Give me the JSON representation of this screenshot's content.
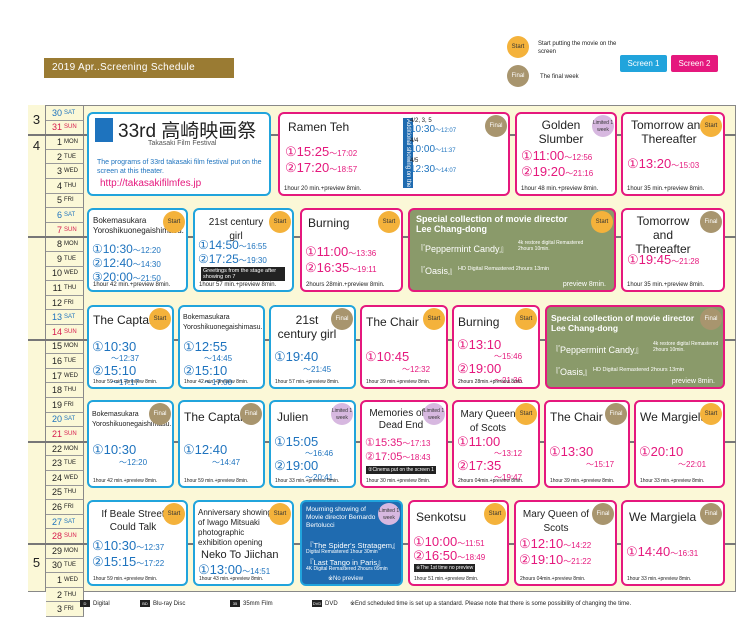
{
  "header": {
    "band": "2019 Apr..Screening Schedule"
  },
  "legend": {
    "start_badge": "Start",
    "start_text": "Start putting the movie on the screen",
    "final_badge": "Final",
    "final_text": "The final week",
    "screen1": "Screen 1",
    "screen2": "Screen 2"
  },
  "festival": {
    "logo": "33rd 高崎映画祭",
    "sub": "Takasaki Film Festival",
    "desc": "The programs of 33rd takasaki film festival put on the screen at this theater.",
    "url": "http://takasakifilmfes.jp"
  },
  "months": [
    "3",
    "4",
    "5"
  ],
  "days": [
    {
      "n": "30",
      "w": "SAT"
    },
    {
      "n": "31",
      "w": "SUN"
    },
    {
      "n": "1",
      "w": "MON"
    },
    {
      "n": "2",
      "w": "TUE"
    },
    {
      "n": "3",
      "w": "WED"
    },
    {
      "n": "4",
      "w": "THU"
    },
    {
      "n": "5",
      "w": "FRI"
    },
    {
      "n": "6",
      "w": "SAT"
    },
    {
      "n": "7",
      "w": "SUN"
    },
    {
      "n": "8",
      "w": "MON"
    },
    {
      "n": "9",
      "w": "TUE"
    },
    {
      "n": "10",
      "w": "WED"
    },
    {
      "n": "11",
      "w": "THU"
    },
    {
      "n": "12",
      "w": "FRI"
    },
    {
      "n": "13",
      "w": "SAT"
    },
    {
      "n": "14",
      "w": "SUN"
    },
    {
      "n": "15",
      "w": "MON"
    },
    {
      "n": "16",
      "w": "TUE"
    },
    {
      "n": "17",
      "w": "WED"
    },
    {
      "n": "18",
      "w": "THU"
    },
    {
      "n": "19",
      "w": "FRI"
    },
    {
      "n": "20",
      "w": "SAT"
    },
    {
      "n": "21",
      "w": "SUN"
    },
    {
      "n": "22",
      "w": "MON"
    },
    {
      "n": "23",
      "w": "TUE"
    },
    {
      "n": "24",
      "w": "WED"
    },
    {
      "n": "25",
      "w": "THU"
    },
    {
      "n": "26",
      "w": "FRI"
    },
    {
      "n": "27",
      "w": "SAT"
    },
    {
      "n": "28",
      "w": "SUN"
    },
    {
      "n": "29",
      "w": "MON"
    },
    {
      "n": "30",
      "w": "TUE"
    },
    {
      "n": "1",
      "w": "WED"
    },
    {
      "n": "2",
      "w": "THU"
    },
    {
      "n": "3",
      "w": "FRI"
    }
  ],
  "films": {
    "ramen": {
      "title": "Ramen Teh",
      "t1": "①15:25",
      "e1": "～17:02",
      "t2": "②17:20",
      "e2": "～18:57",
      "foot": "1hour 20 min.+preview 8min.",
      "badge": "Final"
    },
    "addl": {
      "text": "Additional showing on the 1st floor",
      "d1": "4/2, 3, 5",
      "t1": "10:30",
      "e1": "～12:07",
      "d2": "4/4",
      "t2": "10:00",
      "e2": "～11:37",
      "d3": "4/5",
      "t3": "12:30",
      "e3": "～14:07"
    },
    "golden": {
      "title": "Golden Slumber",
      "t1": "①11:00",
      "e1": "～12:56",
      "t2": "②19:20",
      "e2": "～21:16",
      "foot": "1hour 48 min.+preview 8min.",
      "badge": "Limited 1 week"
    },
    "tomorrow1": {
      "title": "Tomorrow and Thereafter",
      "t1": "①13:20",
      "e1": "～15:03",
      "foot": "1hour 35 min.+preview 8min.",
      "badge": "Start"
    },
    "boke1": {
      "title": "Bokemasukara Yoroshikuonegaishimasu.",
      "t1": "①10:30",
      "e1": "～12:20",
      "t2": "②12:40",
      "e2": "～14:30",
      "t3": "③20:00",
      "e3": "～21:50",
      "foot": "1hour 42 min.+preview 8min.",
      "badge": "Start"
    },
    "century1": {
      "title": "21st century girl",
      "t1": "①14:50",
      "e1": "～16:55",
      "t2": "②17:25",
      "e2": "～19:30",
      "note": "Greetings from the stage after showing on 7",
      "foot": "1hour 57 min.+preview 8min.",
      "badge": "Start"
    },
    "burning1": {
      "title": "Burning",
      "t1": "①11:00",
      "e1": "～13:36",
      "t2": "②16:35",
      "e2": "～19:11",
      "foot": "2hours 28min.+preview 8min.",
      "badge": "Start"
    },
    "special1": {
      "title": "Special collection of movie director Lee Chang-dong",
      "l1": "『Peppermint Candy』",
      "l1b": "4k restore digital Remastered 2hours 10min.",
      "l2": "『Oasis』",
      "l2b": "HD Digital Remastered 2hours 13min",
      "foot": "preview 8min.",
      "badge": "Start"
    },
    "tomorrow2": {
      "title": "Tomorrow and Thereafter",
      "t1": "①19:45",
      "e1": "～21:28",
      "foot": "1hour 35 min.+preview 8min.",
      "badge": "Final"
    },
    "captain1": {
      "title": "The Captain",
      "t1": "①10:30",
      "e1": "～12:37",
      "t2": "②15:10",
      "e2": "～17:17",
      "foot": "1hour 59 min.+preview 8min.",
      "badge": "Start"
    },
    "boke2": {
      "title": "Bokemasukara Yoroshikuonegaishimasu.",
      "t1": "①12:55",
      "e1": "～14:45",
      "t2": "②15:10",
      "e2": "～17:00",
      "foot": "1hour 42 min.+preview 8min.",
      "badge": ""
    },
    "century2": {
      "title": "21st century girl",
      "t1": "①19:40",
      "e1": "～21:45",
      "foot": "1hour 57 min.+preview 8min.",
      "badge": "Final"
    },
    "chair1": {
      "title": "The Chair",
      "t1": "①10:45",
      "e1": "～12:32",
      "foot": "1hour 39 min.+preview 8min.",
      "badge": "Start"
    },
    "burning2": {
      "title": "Burning",
      "t1": "①13:10",
      "e1": "～15:46",
      "t2": "②19:00",
      "e2": "～21:36",
      "foot": "2hours 28min.+preview 8min.",
      "badge": "Start"
    },
    "special2": {
      "title": "Special collection of movie director Lee Chang-dong",
      "l1": "『Peppermint Candy』",
      "l1b": "4k restore digital Remastered 2hours 10min.",
      "l2": "『Oasis』",
      "l2b": "HD Digital Remastered 2hours 13min",
      "foot": "preview 8min.",
      "badge": "Final"
    },
    "boke3": {
      "title": "Bokemasukara Yoroshikuonegaishimasu.",
      "t1": "①10:30",
      "e1": "～12:20",
      "foot": "1hour 42 min.+preview 8min.",
      "badge": "Final"
    },
    "captain2": {
      "title": "The Captain",
      "t1": "①12:40",
      "e1": "～14:47",
      "foot": "1hour 59 min.+preview 8min.",
      "badge": "Final"
    },
    "julien": {
      "title": "Julien",
      "t1": "①15:05",
      "e1": "～16:46",
      "t2": "②19:00",
      "e2": "～20:41",
      "foot": "1hour 33 min.+preview 8min.",
      "badge": "Limited 1 week"
    },
    "memories": {
      "title": "Memories of a Dead End",
      "t1": "①15:35",
      "e1": "～17:13",
      "t2": "②17:05",
      "e2": "～18:43",
      "note": "②Cinema put on the screen 1",
      "foot": "1hour 30 min.+preview 8min.",
      "badge": "Limited 1 week"
    },
    "mary1": {
      "title": "Mary Queen of Scots",
      "t1": "①11:00",
      "e1": "～13:12",
      "t2": "②17:35",
      "e2": "～19:47",
      "foot": "2hours 04min.+preview 8min.",
      "badge": "Start"
    },
    "chair2": {
      "title": "The Chair",
      "t1": "①13:30",
      "e1": "～15:17",
      "foot": "1hour 39 min.+preview 8min.",
      "badge": "Final"
    },
    "margiela1": {
      "title": "We Margiela",
      "t1": "①20:10",
      "e1": "～22:01",
      "foot": "1hour 33 min.+preview 8min.",
      "badge": "Start"
    },
    "beale": {
      "title": "If Beale Street Could Talk",
      "t1": "①10:30",
      "e1": "～12:37",
      "t2": "②15:15",
      "e2": "～17:22",
      "foot": "1hour 59 min.+preview 8min.",
      "badge": "Start"
    },
    "neko": {
      "title": "Anniversary showing of Iwago Mitsuaki photographic exhibition opening",
      "title2": "Neko To Jiichan",
      "t1": "①13:00",
      "e1": "～14:51",
      "foot": "1hour 43 min.+preview 8min.",
      "badge": "Start"
    },
    "mourning": {
      "title": "Mourning showing of Movie director Bernardo Bertolucci",
      "l1": "『The Spider's Stratagem』",
      "l1b": "Digital Remastered 1hour 30min",
      "l2": "『Last Tango in Paris』",
      "l2b": "4K Digital Remastered 2hours 09min",
      "foot": "※No preview",
      "badge": "Limited 1 week"
    },
    "senkotsu": {
      "title": "Senkotsu",
      "t1": "①10:00",
      "e1": "～11:51",
      "t2": "②16:50",
      "e2": "～18:49",
      "note": "※The 1st time no preview",
      "foot": "1hour 51 min.+preview 8min.",
      "badge": "Start"
    },
    "mary2": {
      "title": "Mary Queen of Scots",
      "t1": "①12:10",
      "e1": "～14:22",
      "t2": "②19:10",
      "e2": "～21:22",
      "foot": "2hours 04min.+preview 8min.",
      "badge": "Final"
    },
    "margiela2": {
      "title": "We Margiela",
      "t1": "①14:40",
      "e1": "～16:31",
      "foot": "1hour 33 min.+preview 8min.",
      "badge": "Final"
    }
  },
  "footer": {
    "digital": "Digital",
    "bluray": "Blu-ray Disc",
    "film": "35mm Film",
    "dvd": "DVD",
    "note": "※End scheduled time is set up a standard. Please note that there is some possibility of changing the time."
  }
}
